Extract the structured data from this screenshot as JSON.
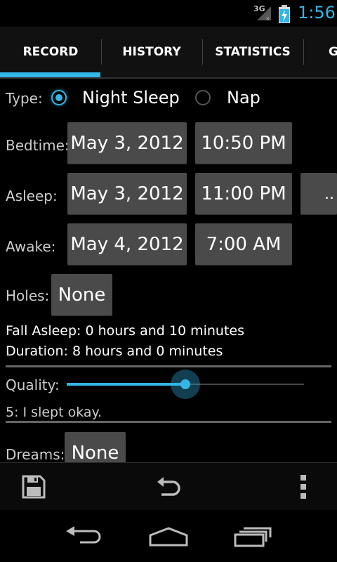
{
  "status_bar": {
    "network": "3G",
    "time": "1:56"
  },
  "tabs": [
    {
      "label": "RECORD"
    },
    {
      "label": "HISTORY"
    },
    {
      "label": "STATISTICS"
    },
    {
      "label": "G"
    }
  ],
  "record": {
    "type_label": "Type:",
    "type_options": [
      {
        "label": "Night Sleep",
        "selected": true
      },
      {
        "label": "Nap",
        "selected": false
      }
    ],
    "bedtime": {
      "label": "Bedtime:",
      "date": "May 3, 2012",
      "time": "10:50 PM"
    },
    "asleep": {
      "label": "Asleep:",
      "date": "May 3, 2012",
      "time": "11:00 PM",
      "extra": ".."
    },
    "awake": {
      "label": "Awake:",
      "date": "May 4, 2012",
      "time": "7:00 AM"
    },
    "holes": {
      "label": "Holes:",
      "value": "None"
    },
    "fall_asleep_text": "Fall Asleep: 0 hours and 10 minutes",
    "duration_text": "Duration: 8 hours and 0 minutes",
    "quality": {
      "label": "Quality:",
      "value": 5,
      "max": 10,
      "description": "5: I slept okay."
    },
    "dreams": {
      "label": "Dreams:",
      "value": "None"
    }
  },
  "colors": {
    "accent": "#33b5e5",
    "button": "#4a4a4a",
    "background": "#000000"
  },
  "action_bar": {
    "icons": [
      "save-icon",
      "undo-icon",
      "overflow-menu-icon"
    ]
  },
  "nav_bar": {
    "icons": [
      "back-icon",
      "home-icon",
      "recent-apps-icon"
    ]
  }
}
